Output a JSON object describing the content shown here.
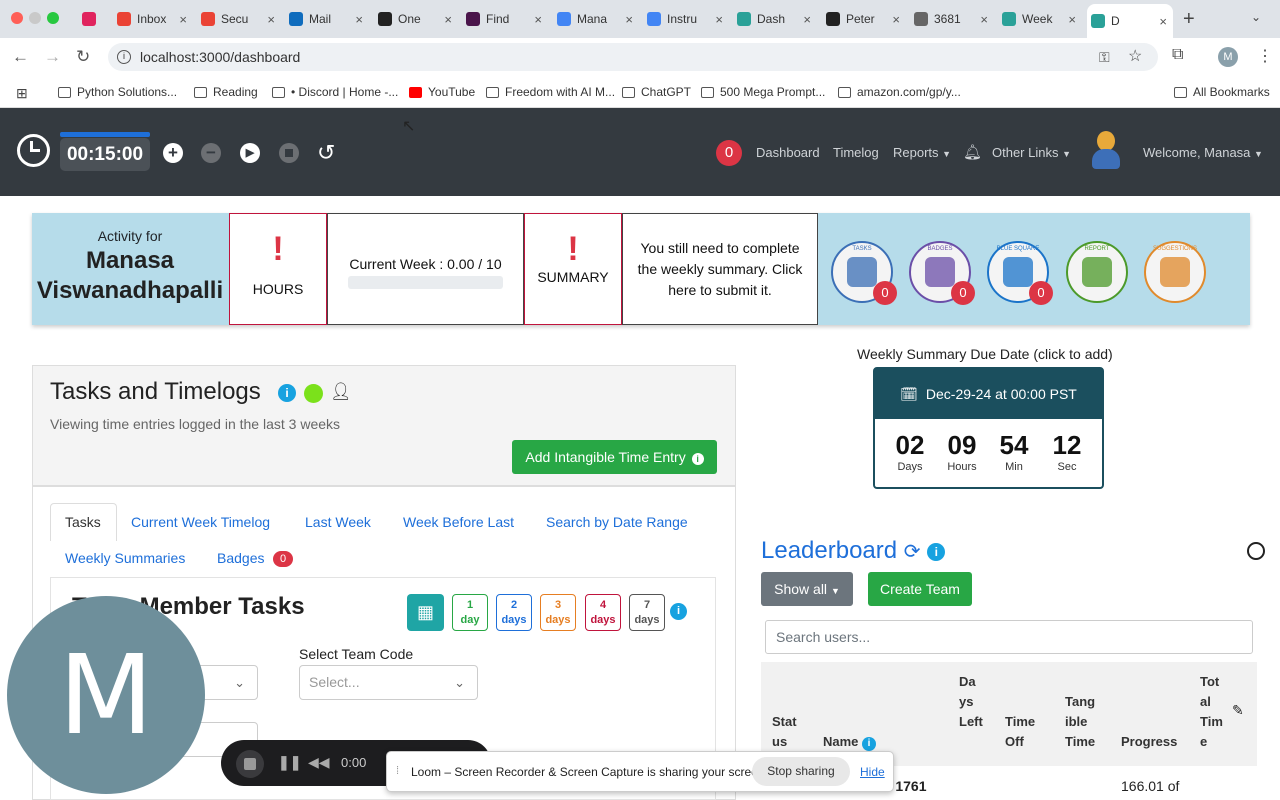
{
  "browser": {
    "tabs": [
      {
        "label": "",
        "icon": "loom-icon"
      },
      {
        "label": "Inbox",
        "icon": "gmail-icon"
      },
      {
        "label": "Secu",
        "icon": "gmail-icon"
      },
      {
        "label": "Mail",
        "icon": "outlook-icon"
      },
      {
        "label": "One",
        "icon": "onelogin-icon"
      },
      {
        "label": "Find",
        "icon": "slack-icon"
      },
      {
        "label": "Mana",
        "icon": "docs-icon"
      },
      {
        "label": "Instru",
        "icon": "docs-icon"
      },
      {
        "label": "Dash",
        "icon": "app-icon"
      },
      {
        "label": "Peter",
        "icon": "github-icon"
      },
      {
        "label": "3681",
        "icon": "globe-icon"
      },
      {
        "label": "Week",
        "icon": "app-icon"
      },
      {
        "label": "D",
        "icon": "app-icon"
      }
    ],
    "url": "localhost:3000/dashboard",
    "bookmarks": [
      "Python Solutions...",
      "Reading",
      "• Discord | Home -...",
      "YouTube",
      "Freedom with AI M...",
      "ChatGPT",
      "500 Mega Prompt...",
      "amazon.com/gp/y..."
    ],
    "all_bookmarks": "All Bookmarks"
  },
  "navbar": {
    "timer": "00:15:00",
    "notification_count": "0",
    "links": [
      "Dashboard",
      "Timelog",
      "Reports",
      "Other Links"
    ],
    "welcome": "Welcome, Manasa"
  },
  "activity": {
    "label": "Activity for",
    "name_line1": "Manasa",
    "name_line2": "Viswanadhapalli",
    "hours_label": "HOURS",
    "exclaim": "!",
    "current_week": "Current Week : 0.00 / 10",
    "summary_label": "SUMMARY",
    "summary_msg": "You still need to complete the weekly summary. Click here to submit it.",
    "awards": [
      {
        "name": "TASKS",
        "count": "0",
        "color": "#3b6fb6"
      },
      {
        "name": "BADGES",
        "count": "0",
        "color": "#6b4fa8"
      },
      {
        "name": "BLUE SQUARE",
        "count": "0",
        "color": "#1b74c9"
      },
      {
        "name": "REPORT",
        "count": "",
        "color": "#4c9a2a"
      },
      {
        "name": "SUGGESTIONS",
        "count": "",
        "color": "#e08a2c"
      }
    ]
  },
  "tasks": {
    "title": "Tasks and Timelogs",
    "subtitle": "Viewing time entries logged in the last 3 weeks",
    "add_button": "Add Intangible Time Entry",
    "tabs": [
      "Tasks",
      "Current Week Timelog",
      "Last Week",
      "Week Before Last",
      "Search by Date Range",
      "Weekly Summaries",
      "Badges"
    ],
    "badges_count": "0",
    "team_member_tasks": "Team Member Tasks",
    "team_code_label": "Select Team Code",
    "team_code_placeholder": "Select...",
    "day_filters": [
      {
        "n": "1",
        "u": "day",
        "color": "#28a745"
      },
      {
        "n": "2",
        "u": "days",
        "color": "#1e6fd9"
      },
      {
        "n": "3",
        "u": "days",
        "color": "#e67e22"
      },
      {
        "n": "4",
        "u": "days",
        "color": "#c0143c"
      },
      {
        "n": "7",
        "u": "days",
        "color": "#555555"
      }
    ]
  },
  "due": {
    "label": "Weekly Summary Due Date (click to add)",
    "date": "Dec-29-24 at 00:00 PST",
    "countdown": [
      {
        "n": "02",
        "l": "Days"
      },
      {
        "n": "09",
        "l": "Hours"
      },
      {
        "n": "54",
        "l": "Min"
      },
      {
        "n": "12",
        "l": "Sec"
      }
    ]
  },
  "leaderboard": {
    "title": "Leaderboard",
    "show_all": "Show all",
    "create_team": "Create Team",
    "search_placeholder": "Search users...",
    "headers": [
      "Stat us",
      "Name",
      "Da ys Left",
      "Time Off",
      "Tang ible Time",
      "Progress",
      "Tot al Tim e"
    ],
    "row_hours": "s: 1761",
    "row_progress": "166.01 of"
  },
  "loom": {
    "letter": "M",
    "time": "0:00",
    "sharing_msg": "Loom – Screen Recorder & Screen Capture is sharing your screen.",
    "stop": "Stop sharing",
    "hide": "Hide"
  }
}
